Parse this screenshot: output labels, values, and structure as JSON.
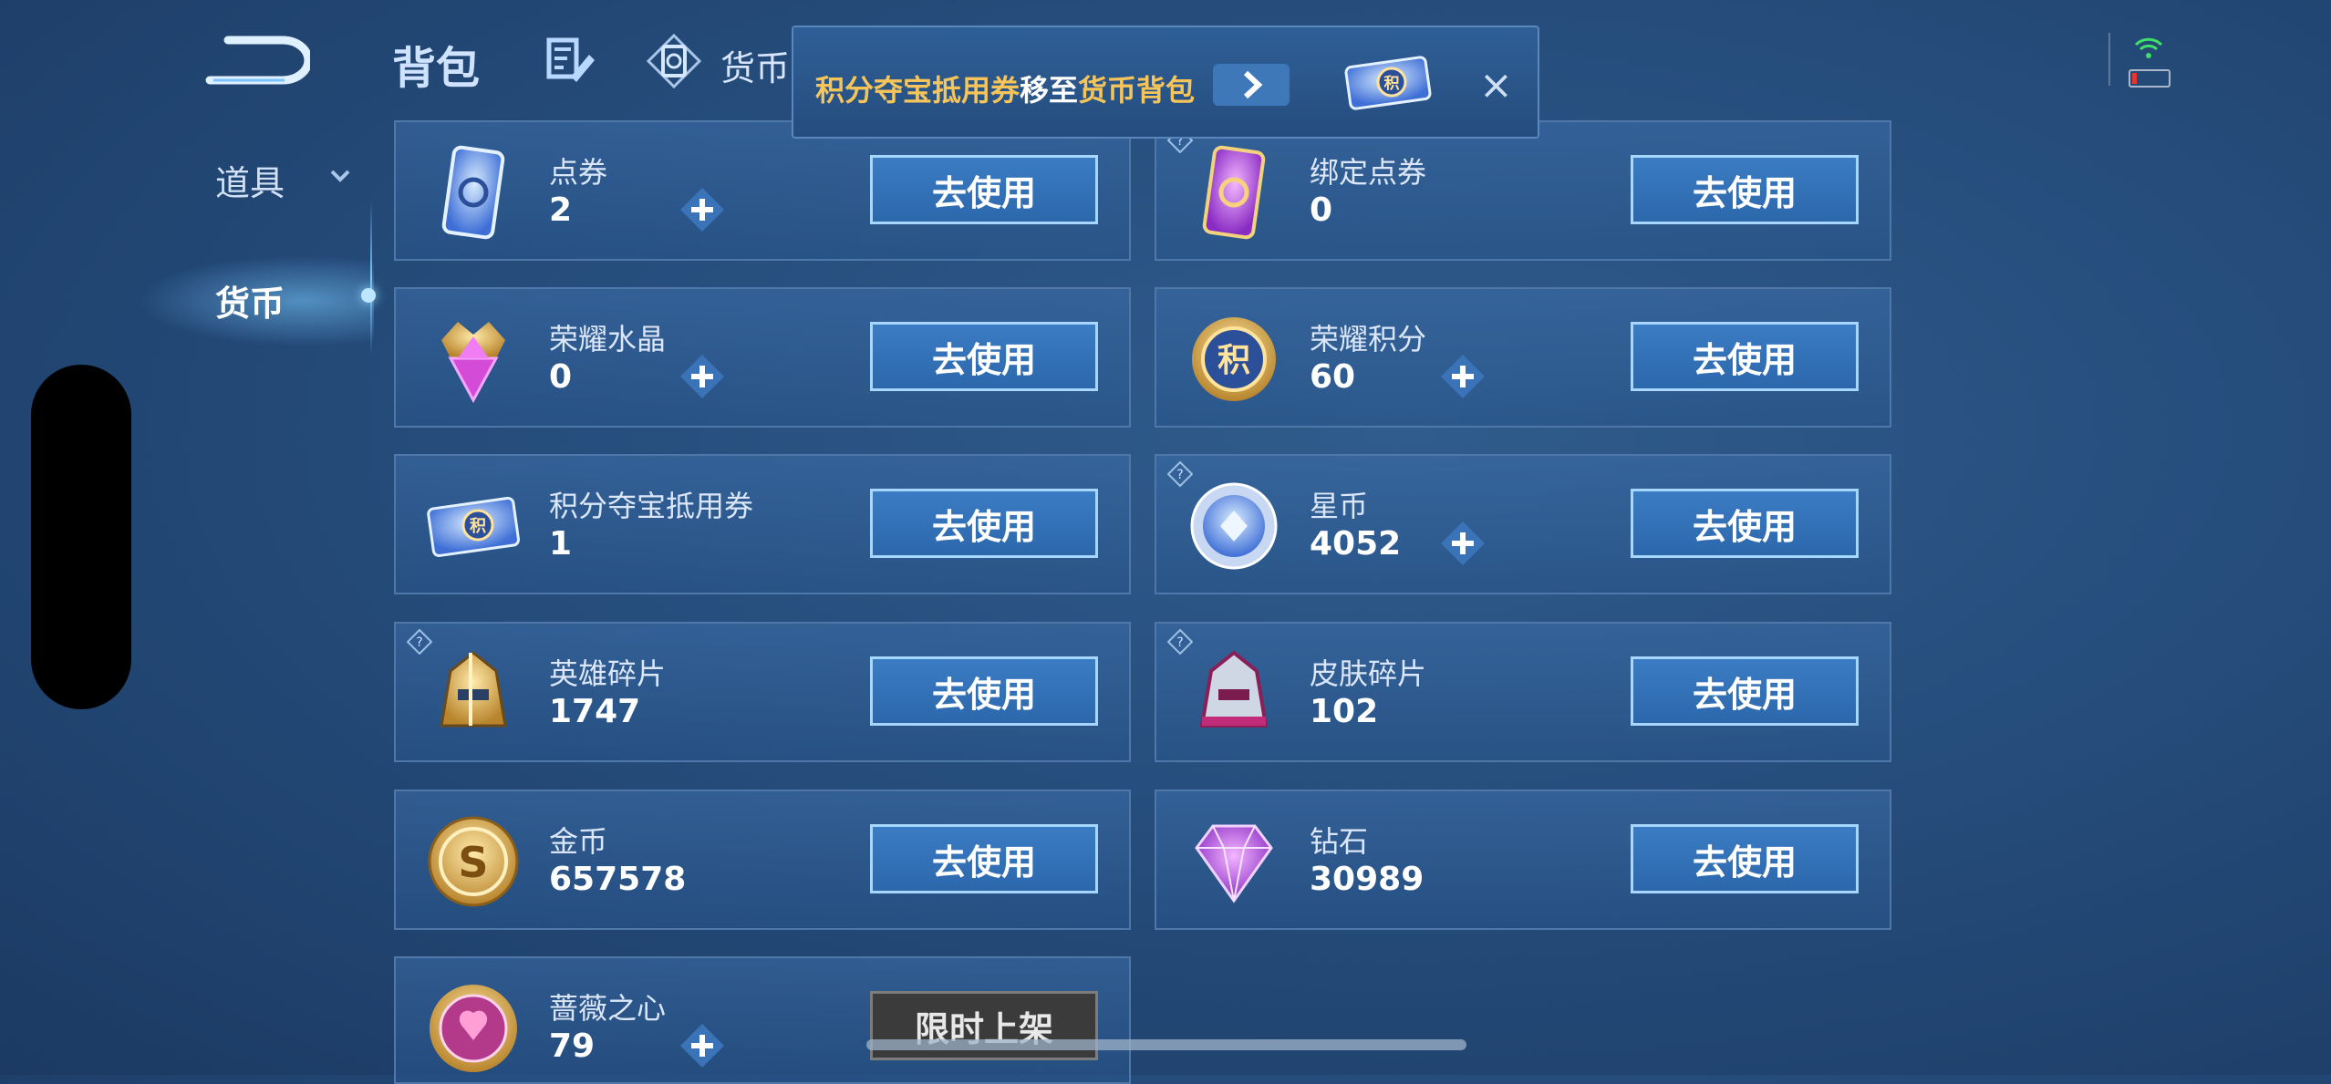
{
  "header": {
    "tab_bag": "背包",
    "tab_currency": "货币"
  },
  "banner": {
    "part1": "积分夺宝抵用券",
    "part2": "移至",
    "part3": "货币背包",
    "close": "×"
  },
  "sidebar": {
    "items": [
      {
        "label": "道具"
      },
      {
        "label": "货币"
      }
    ]
  },
  "cards": [
    {
      "name": "点券",
      "value": "2",
      "button": "去使用"
    },
    {
      "name": "绑定点券",
      "value": "0",
      "button": "去使用"
    },
    {
      "name": "荣耀水晶",
      "value": "0",
      "button": "去使用"
    },
    {
      "name": "荣耀积分",
      "value": "60",
      "button": "去使用"
    },
    {
      "name": "积分夺宝抵用券",
      "value": "1",
      "button": "去使用"
    },
    {
      "name": "星币",
      "value": "4052",
      "button": "去使用"
    },
    {
      "name": "英雄碎片",
      "value": "1747",
      "button": "去使用"
    },
    {
      "name": "皮肤碎片",
      "value": "102",
      "button": "去使用"
    },
    {
      "name": "金币",
      "value": "657578",
      "button": "去使用"
    },
    {
      "name": "钻石",
      "value": "30989",
      "button": "去使用"
    },
    {
      "name": "蔷薇之心",
      "value": "79",
      "button": "限时上架"
    }
  ],
  "colors": {
    "accent": "#3b7cc4",
    "gold_text": "#f6c55a",
    "background": "#264d7c"
  }
}
